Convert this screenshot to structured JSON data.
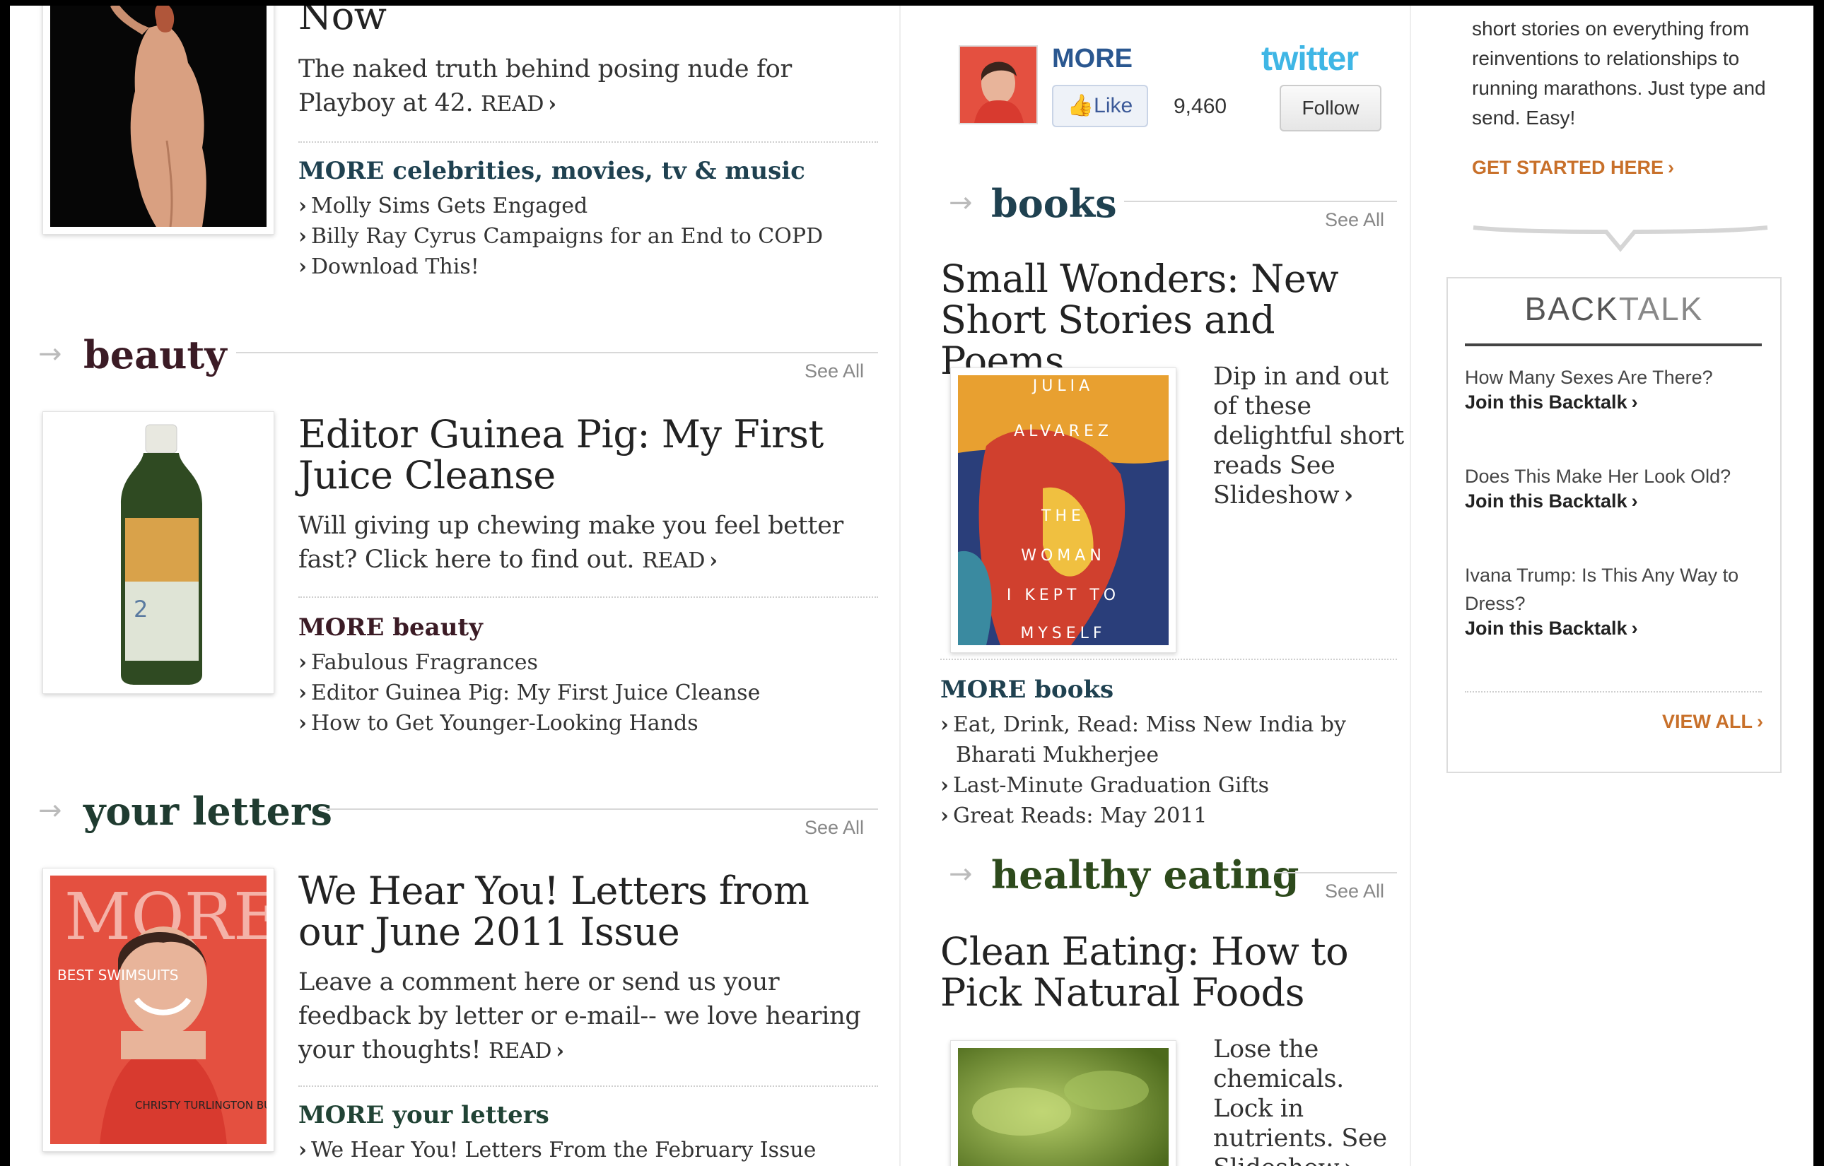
{
  "left": {
    "top_story": {
      "title_tail": "Now",
      "desc": "The naked truth behind posing nude for Playboy at 42.",
      "read": "READ",
      "more_heading": "MORE celebrities, movies, tv & music",
      "more_items": [
        "Molly Sims Gets Engaged",
        "Billy Ray Cyrus Campaigns for an End to COPD",
        "Download This!"
      ]
    },
    "beauty": {
      "section": "beauty",
      "see_all": "See All",
      "title": "Editor Guinea Pig: My First Juice Cleanse",
      "desc": "Will giving up chewing make you feel better fast? Click here to find out.",
      "read": "READ",
      "more_heading": "MORE beauty",
      "more_items": [
        "Fabulous Fragrances",
        "Editor Guinea Pig: My First Juice Cleanse",
        "How to Get Younger-Looking Hands"
      ]
    },
    "letters": {
      "section": "your letters",
      "see_all": "See All",
      "title": "We Hear You! Letters from our June 2011 Issue",
      "desc": "Leave a comment here or send us your feedback by letter or e-mail-- we love hearing your thoughts!",
      "read": "READ",
      "more_heading": "MORE your letters",
      "more_items": [
        "We Hear You! Letters From the February Issue"
      ],
      "cover_brand": "MORE",
      "cover_best": "BEST SWIMSUITS",
      "cover_name": "CHRISTY TURLINGTON BURNS"
    }
  },
  "middle": {
    "social": {
      "brand": "MORE",
      "like": "Like",
      "like_count": "9,460",
      "twitter": "twitter",
      "follow": "Follow"
    },
    "books": {
      "section": "books",
      "see_all": "See All",
      "title": "Small Wonders: New Short Stories and Poems",
      "desc": "Dip in and out of these delightful short reads",
      "see": "See",
      "slideshow": "Slideshow",
      "book_cover_lines": [
        "JULIA",
        "ALVAREZ",
        "THE",
        "WOMAN",
        "I KEPT TO",
        "MYSELF"
      ],
      "more_heading": "MORE books",
      "more_items": [
        "Eat, Drink, Read: Miss New India by Bharati Mukherjee",
        "Last-Minute Graduation Gifts",
        "Great Reads: May 2011"
      ]
    },
    "healthy": {
      "section": "healthy eating",
      "see_all": "See All",
      "title": "Clean Eating: How to Pick Natural Foods",
      "desc": "Lose the chemicals. Lock in nutrients.",
      "see": "See",
      "slideshow": "Slideshow"
    }
  },
  "right": {
    "intro": "short stories on everything from reinventions to relationships to running marathons. Just type and send. Easy!",
    "get_started": "GET STARTED HERE",
    "backtalk": {
      "title_a": "BACK",
      "title_b": "TALK",
      "items": [
        {
          "question": "How Many Sexes Are There?",
          "join": "Join this Backtalk"
        },
        {
          "question": "Does This Make Her Look Old?",
          "join": "Join this Backtalk"
        },
        {
          "question": "Ivana Trump: Is This Any Way to Dress?",
          "join": "Join this Backtalk"
        }
      ],
      "view_all": "VIEW ALL"
    }
  },
  "colors": {
    "beauty": "#3b1b25",
    "letters": "#1f3b30",
    "books": "#1f4150",
    "healthy": "#2d4a1c",
    "orange": "#c8702a",
    "twitter": "#3fb6e5"
  }
}
